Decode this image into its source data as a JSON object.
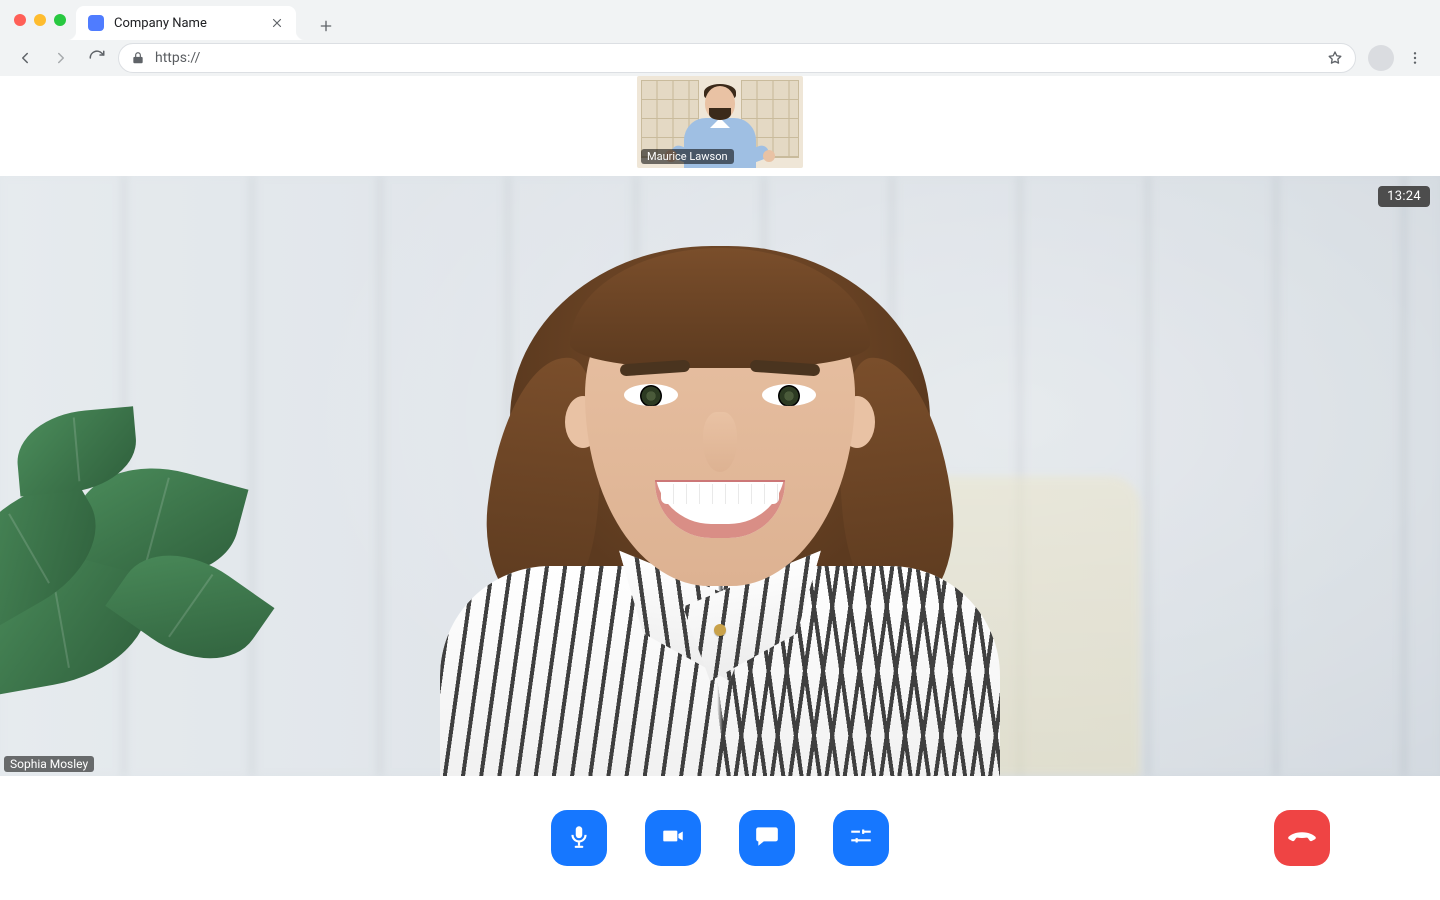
{
  "chrome": {
    "tab_title": "Company Name",
    "url_text": "https://"
  },
  "call": {
    "timer": "13:24",
    "main_participant_name": "Sophia Mosley",
    "thumb_participant_name": "Maurice Lawson"
  },
  "controls": {
    "mic": "microphone",
    "camera": "camera",
    "chat": "chat",
    "settings": "settings",
    "end": "end-call"
  },
  "colors": {
    "control_blue": "#1677ff",
    "end_red": "#ef4444"
  }
}
